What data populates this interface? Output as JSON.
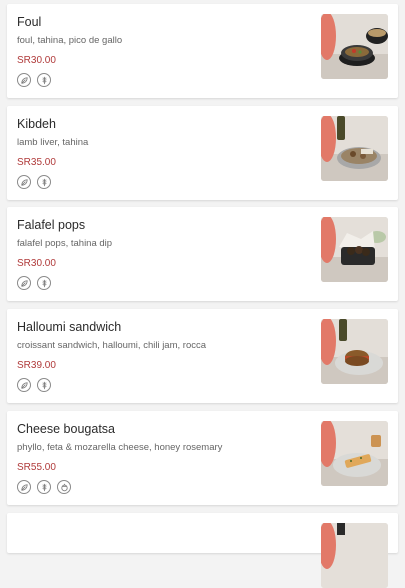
{
  "items": [
    {
      "name": "Foul",
      "description": "foul, tahina, pico de gallo",
      "price": "SR30.00",
      "icons": [
        "vegetarian-icon",
        "gluten-icon"
      ],
      "image": "foul-dish-image"
    },
    {
      "name": "Kibdeh",
      "description": "lamb liver, tahina",
      "price": "SR35.00",
      "icons": [
        "vegetarian-icon",
        "gluten-icon"
      ],
      "image": "kibdeh-dish-image"
    },
    {
      "name": "Falafel pops",
      "description": "falafel pops, tahina dip",
      "price": "SR30.00",
      "icons": [
        "vegetarian-icon",
        "gluten-icon"
      ],
      "image": "falafel-dish-image"
    },
    {
      "name": "Halloumi sandwich",
      "description": "croissant sandwich, halloumi, chili jam, rocca",
      "price": "SR39.00",
      "icons": [
        "vegetarian-icon",
        "gluten-icon"
      ],
      "image": "halloumi-sandwich-image"
    },
    {
      "name": "Cheese bougatsa",
      "description": "phyllo, feta & mozarella cheese, honey rosemary",
      "price": "SR55.00",
      "icons": [
        "vegetarian-icon",
        "gluten-icon",
        "nuts-icon"
      ],
      "image": "cheese-bougatsa-image"
    }
  ],
  "colors": {
    "price": "#b03a3a",
    "background": "#f3f3f3",
    "card": "#ffffff"
  }
}
